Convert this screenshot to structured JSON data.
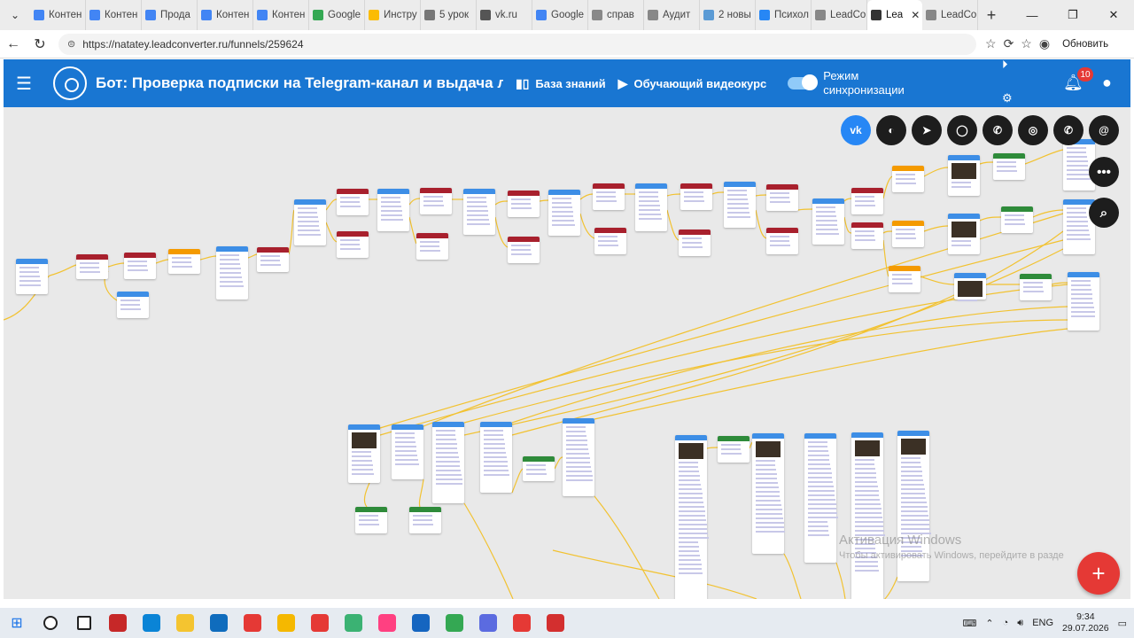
{
  "browser": {
    "tabs": [
      {
        "label": "Контен",
        "color": "#4285f4"
      },
      {
        "label": "Контен",
        "color": "#4285f4"
      },
      {
        "label": "Прода",
        "color": "#4285f4"
      },
      {
        "label": "Контен",
        "color": "#4285f4"
      },
      {
        "label": "Контен",
        "color": "#4285f4"
      },
      {
        "label": "Google",
        "color": "#34a853"
      },
      {
        "label": "Инстру",
        "color": "#fbbc04"
      },
      {
        "label": "5 урок",
        "color": "#777777"
      },
      {
        "label": "vk.ru",
        "color": "#555555"
      },
      {
        "label": "Google",
        "color": "#4285f4"
      },
      {
        "label": "справ",
        "color": "#888888"
      },
      {
        "label": "Аудит",
        "color": "#888888"
      },
      {
        "label": "2 новы",
        "color": "#5b9bd5"
      },
      {
        "label": "Психол",
        "color": "#2787f5"
      },
      {
        "label": "LeadCo",
        "color": "#888888"
      },
      {
        "label": "Lea",
        "color": "#333333",
        "active": true
      },
      {
        "label": "LeadCo",
        "color": "#888888"
      }
    ],
    "url": "https://natatey.leadconverter.ru/funnels/259624",
    "update_label": "Обновить"
  },
  "header": {
    "bot_title": "Бот: Проверка подписки на Telegram-канал и выдача лид-магн",
    "knowledge_base": "База знаний",
    "video_course": "Обучающий видеокурс",
    "sync_label": "Режим синхронизации",
    "notifications_count": "10"
  },
  "socials": [
    "vk-icon",
    "messenger-icon",
    "telegram-icon",
    "chat-icon",
    "viber-icon",
    "instagram-icon",
    "whatsapp-icon",
    "email-icon"
  ],
  "watermark": {
    "title": "Активация Windows",
    "subtitle": "Чтобы активировать Windows, перейдите в разде"
  },
  "taskbar": {
    "lang": "ENG",
    "time": "9:34",
    "date": "29.07.2026"
  }
}
